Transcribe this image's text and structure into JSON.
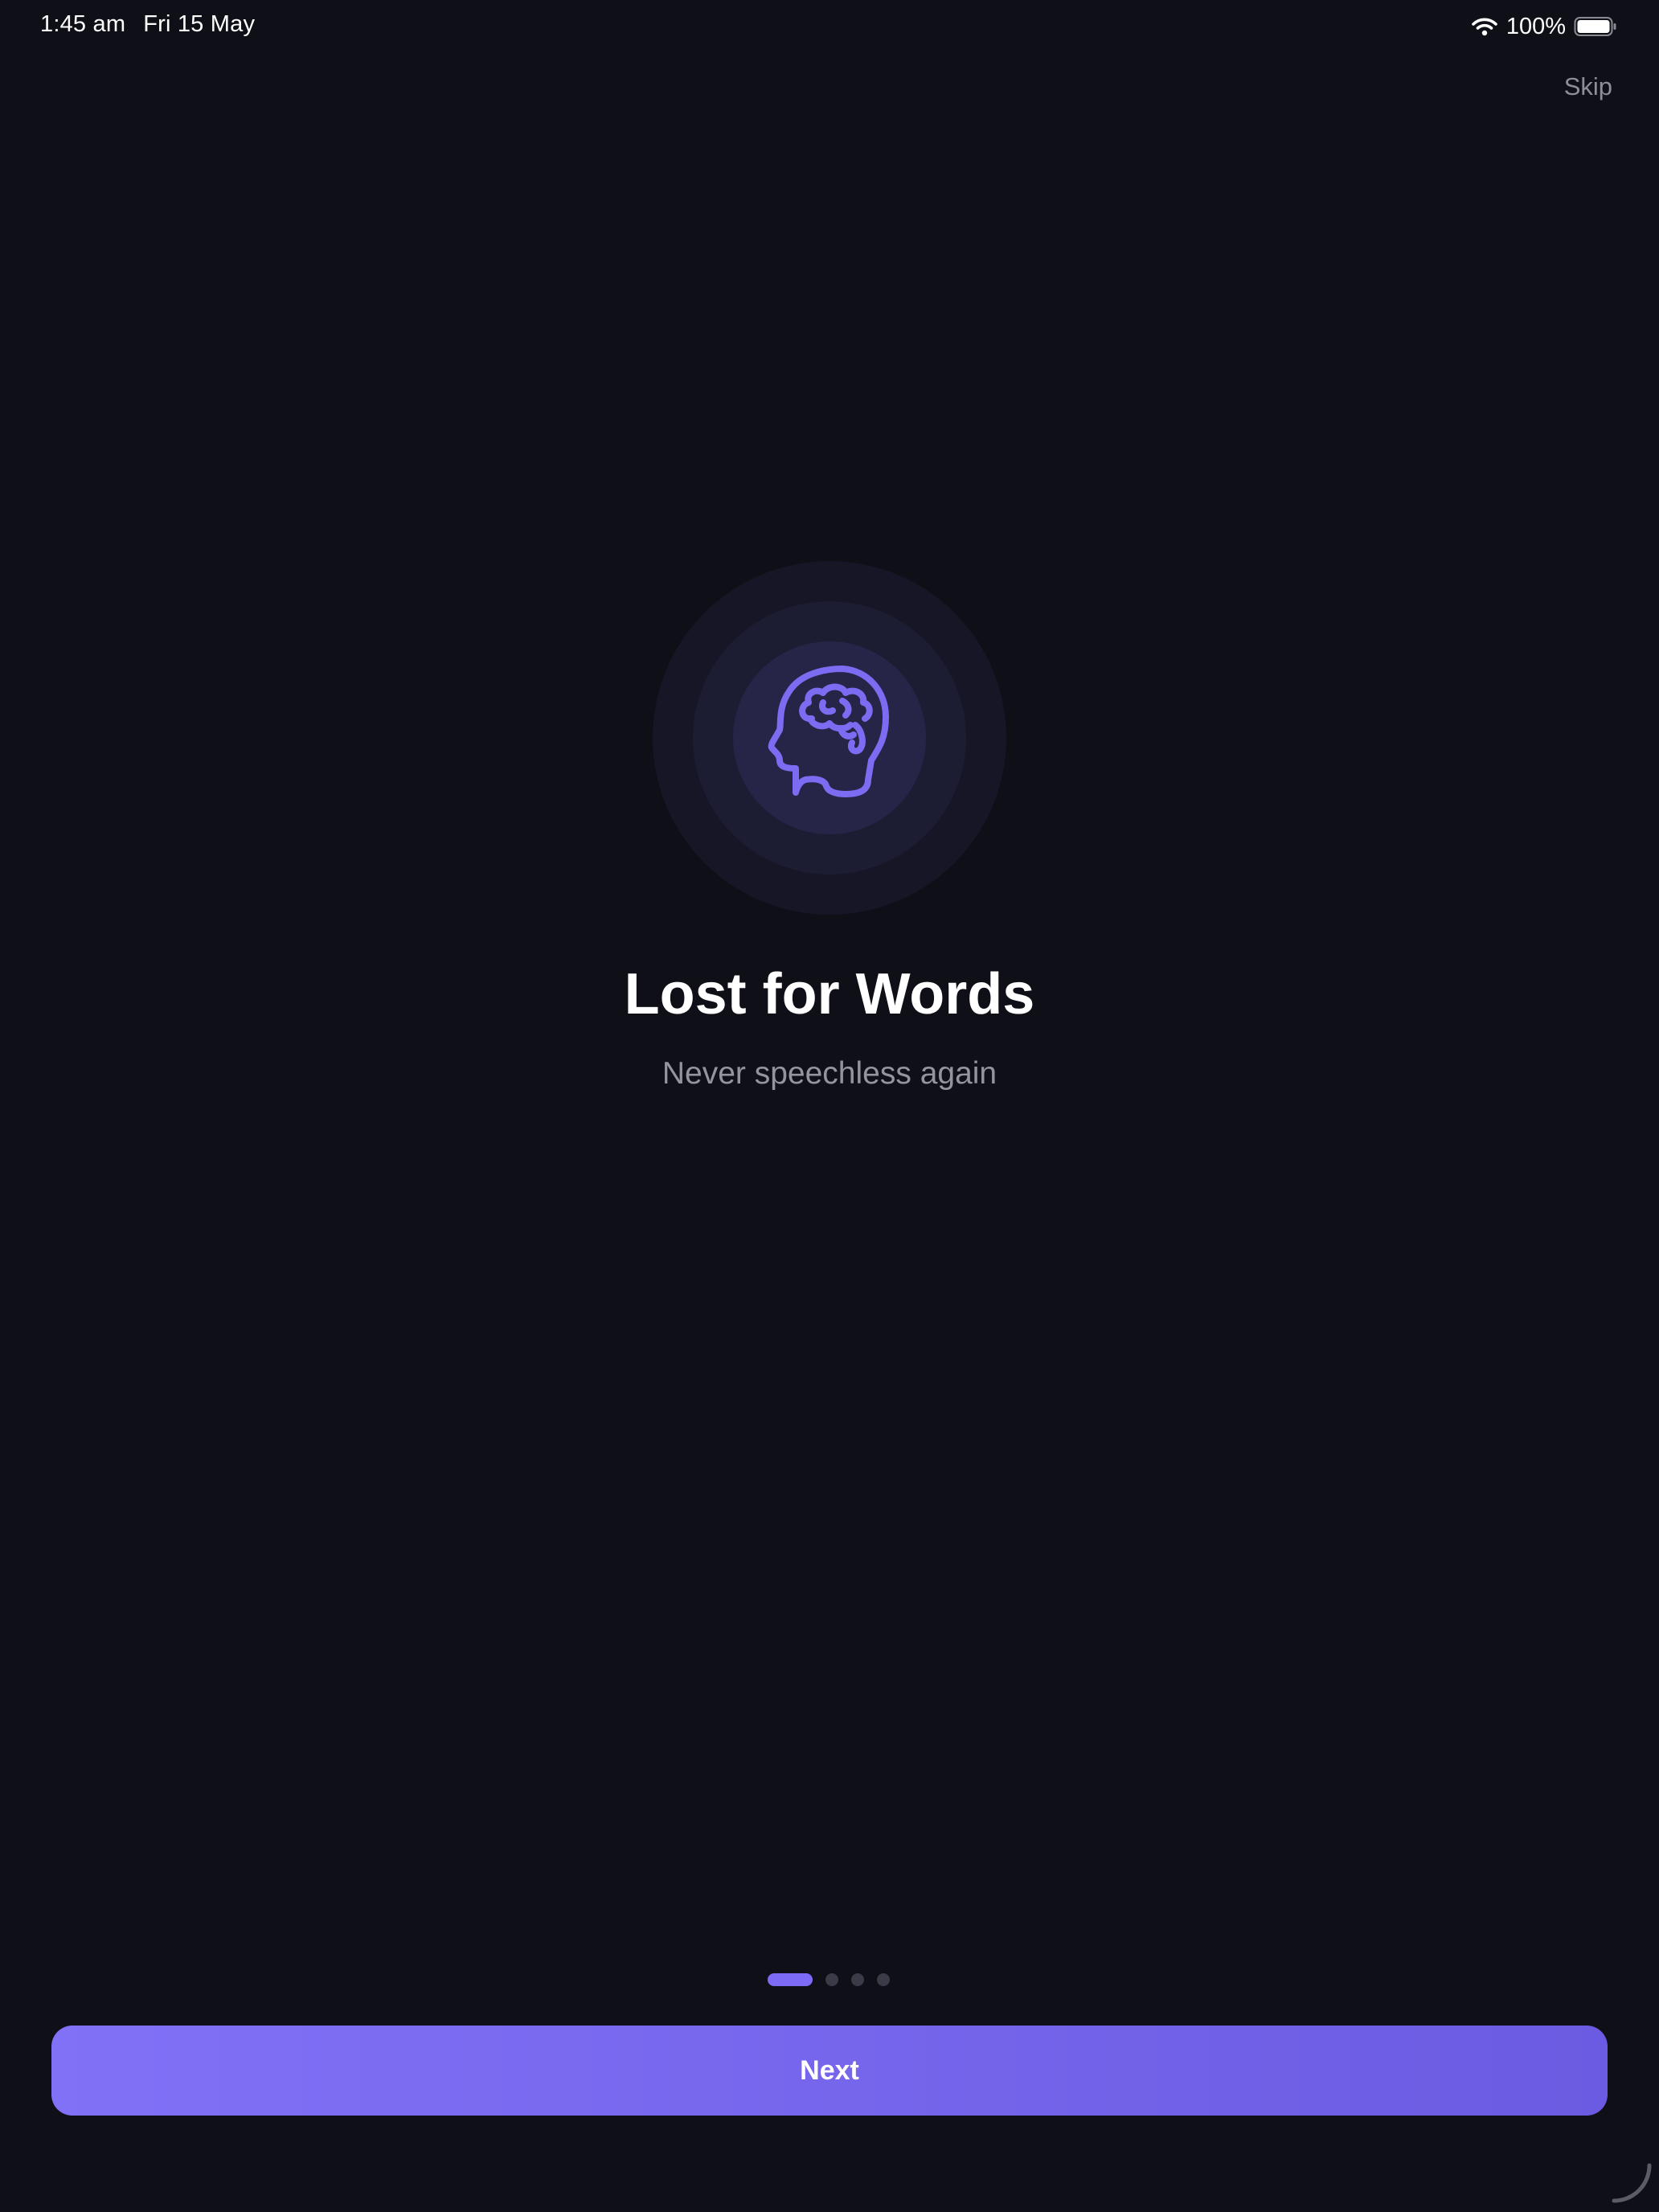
{
  "status_bar": {
    "time": "1:45 am",
    "date": "Fri 15 May",
    "battery_percent": "100%",
    "battery_level": 1.0,
    "icons": [
      "wifi-icon",
      "battery-icon"
    ]
  },
  "header": {
    "skip_label": "Skip"
  },
  "hero": {
    "icon": "brain-head-icon",
    "title": "Lost for Words",
    "subtitle": "Never speechless again"
  },
  "pager": {
    "total_pages": 4,
    "current_page": 1
  },
  "footer": {
    "next_label": "Next"
  },
  "colors": {
    "background": "#0f0f18",
    "accent": "#7c6cf5",
    "button_gradient_start": "#8071f7",
    "button_gradient_end": "#6b5be2",
    "muted_text": "#94949e"
  }
}
